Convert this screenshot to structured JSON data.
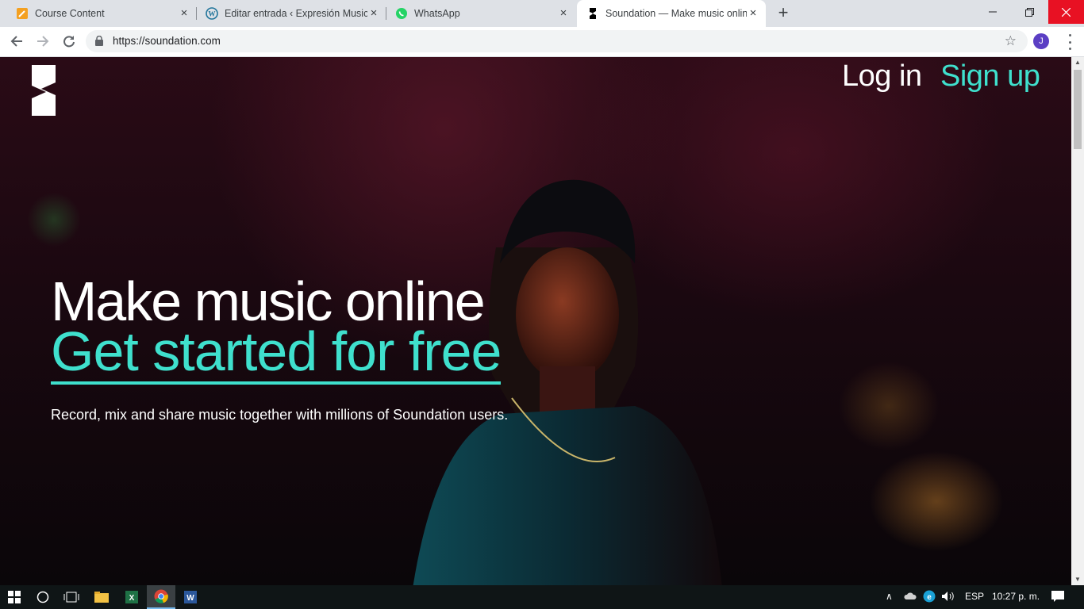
{
  "browser": {
    "tabs": [
      {
        "title": "Course Content",
        "icon": "pencil-icon",
        "active": false
      },
      {
        "title": "Editar entrada ‹ Expresión Musical",
        "icon": "wordpress-icon",
        "active": false
      },
      {
        "title": "WhatsApp",
        "icon": "whatsapp-icon",
        "active": false
      },
      {
        "title": "Soundation — Make music online",
        "icon": "soundation-icon",
        "active": true
      }
    ],
    "url": "https://soundation.com",
    "profile_initial": "J"
  },
  "site": {
    "nav": {
      "login": "Log in",
      "signup": "Sign up"
    },
    "hero": {
      "title": "Make music online",
      "cta": "Get started for free",
      "subtitle": "Record, mix and share music together with millions of Soundation users."
    },
    "colors": {
      "accent": "#3fe0cd"
    }
  },
  "taskbar": {
    "language": "ESP",
    "time": "10:27 p. m."
  }
}
